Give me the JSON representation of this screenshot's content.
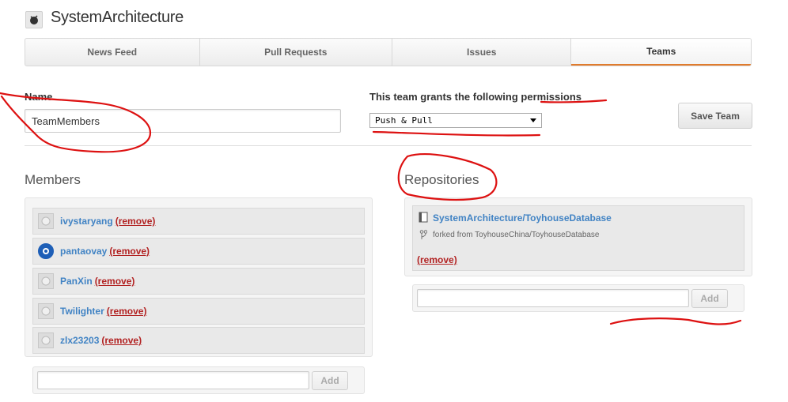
{
  "header": {
    "org_name": "SystemArchitecture"
  },
  "tabs": [
    {
      "label": "News Feed",
      "active": false
    },
    {
      "label": "Pull Requests",
      "active": false
    },
    {
      "label": "Issues",
      "active": false
    },
    {
      "label": "Teams",
      "active": true
    }
  ],
  "form": {
    "name_label": "Name",
    "name_value": "TeamMembers",
    "permissions_label": "This team grants the following permissions",
    "permission_selected": "Push & Pull",
    "save_button": "Save Team"
  },
  "members": {
    "title": "Members",
    "items": [
      {
        "name": "ivystaryang",
        "remove": "(remove)"
      },
      {
        "name": "pantaovay",
        "remove": "(remove)"
      },
      {
        "name": "PanXin",
        "remove": "(remove)"
      },
      {
        "name": "Twilighter",
        "remove": "(remove)"
      },
      {
        "name": "zlx23203",
        "remove": "(remove)"
      }
    ],
    "add_input_value": "",
    "add_button": "Add"
  },
  "repositories": {
    "title": "Repositories",
    "items": [
      {
        "name": "SystemArchitecture/ToyhouseDatabase",
        "fork_info": "forked from ToyhouseChina/ToyhouseDatabase",
        "remove": "(remove)"
      }
    ],
    "add_input_value": "",
    "add_button": "Add"
  },
  "colors": {
    "link": "#4183c4",
    "remove": "#b22222",
    "active_tab_underline": "#e07b2c",
    "annotation": "#dd1111"
  },
  "icons": {
    "org_avatar": "org-logo-icon",
    "member_avatar": "github-octocat-icon",
    "repo": "book-icon",
    "fork": "fork-icon",
    "select_arrow": "caret-down-icon"
  }
}
